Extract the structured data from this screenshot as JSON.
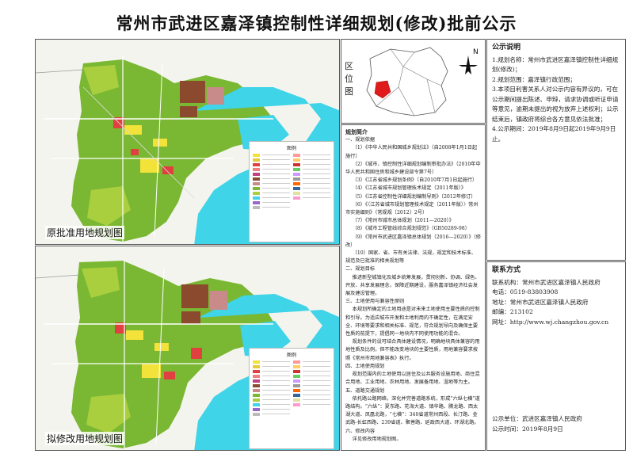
{
  "title": "常州市武进区嘉泽镇控制性详细规划(修改)批前公示",
  "maps": {
    "top_caption": "原批准用地规划图",
    "bottom_caption": "拟修改用地规划图",
    "legend_title": "图例"
  },
  "location": {
    "label": "区位图",
    "north_mark": "N"
  },
  "intro": {
    "heading": "规划简介",
    "items": [
      "一、规划依据",
      "（1）《中华人民共和国城乡规划法》（自2008年1月1日起施行）",
      "（2）《城市、镇控制性详细规划编制审批办法》（2010年中华人民共和国住房和城乡建设部令第7号）",
      "（3）《江苏省城乡规划条例》（自2010年7月1日起施行）",
      "（4）《江苏省城市规划管理技术规定（2011年版）》",
      "（5）《江苏省控制性详细规划编制导则》（2012年修订）",
      "（6）《〈江苏省城市规划管理技术规定（2011年版）〉常州市实施细则》（常规规〔2012〕2号）",
      "（7）《常州市城市总体规划（2011—2020）》",
      "（8）《城市工程管线综合规划规范》（GB50289-98）",
      "（9）《常州市武进区嘉泽镇总体规划（2016—2020）》（修改）",
      "（10）国家、省、市有关法律、法规，规定和技术标准、规范及已批准的相关规划等",
      "二、规划目标",
      "推进新型城镇化及城乡统筹发展，贯彻创新、协调、绿色、开放、共享发展理念，保障近期建设，服务嘉泽镇经济社会发展及建设管理。",
      "三、土地使用与兼容性原则",
      "本规划所确定的土地用途是对未来土地使用主要性质的控制和引导。为适应城市开发和土地利用的不确定性，在满足安全、环境等要求和相关标准、规范，符合规划导向及确保主要性质的前提下，提倡同一地块内不同使用功能的混合。",
      "规划条件的设可结合具体建设情况，明确地块具体兼容的用地性质及比例，但不能改变地块的主要性质，用地兼容要求按照《常州市用地兼容表》执行。",
      "四、土地使用规划",
      "规划范围内的土地使用以居住及公共服务设施用地、商住混合用地、工业用地、农林用地、发展备用地、湿地等为主。",
      "五、道路交通规划",
      "依托路公路网络，深化并完善道路系统，形成“六纵七横”道路结构。“六纵”：夏东路、花海大道、镇华路、腾龙路、西太湖大道、凤凰北路，“七横”：340省道常州西段、长汀路、金武路-长虹西路、239省道、聚善路、延政西大道、环湖北路。",
      "六、修改内容",
      "详见修改用地规划图。"
    ]
  },
  "notice": {
    "heading": "公示说明",
    "items": [
      "1.规划名称：常州市武进区嘉泽镇控制性详细规划(修改)；",
      "2.规划范围：嘉泽镇行政范围；",
      "3.本项目利害关系人对公示内容有异议的，可在公示期间提出陈述、申辩，请求协调或听证申请等意见，逾期未提出的视为放弃上述权利；公示结束后，镇政府将综合各方意见依法批准；",
      "4.公示期间：2019年8月9日起2019年9月9日止。"
    ]
  },
  "contact": {
    "heading": "联系方式",
    "items": [
      "联系机构：常州市武进区嘉泽镇人民政府",
      "电话：0519-83803908",
      "地址：常州市武进区嘉泽镇人民政府",
      "邮编：213102",
      "网址：http://www.wj.changzhou.gov.cn"
    ],
    "announcer": "公示单位：武进区嘉泽镇人民政府",
    "date": "公示时间：2019年8月9日"
  },
  "colors": {
    "residential": "#f2e23a",
    "green": "#7ab833",
    "agri": "#a9cf3f",
    "water": "#3fd4e8",
    "industrial": "#8b4a2e",
    "public": "#e04040",
    "road": "#ffffff"
  }
}
